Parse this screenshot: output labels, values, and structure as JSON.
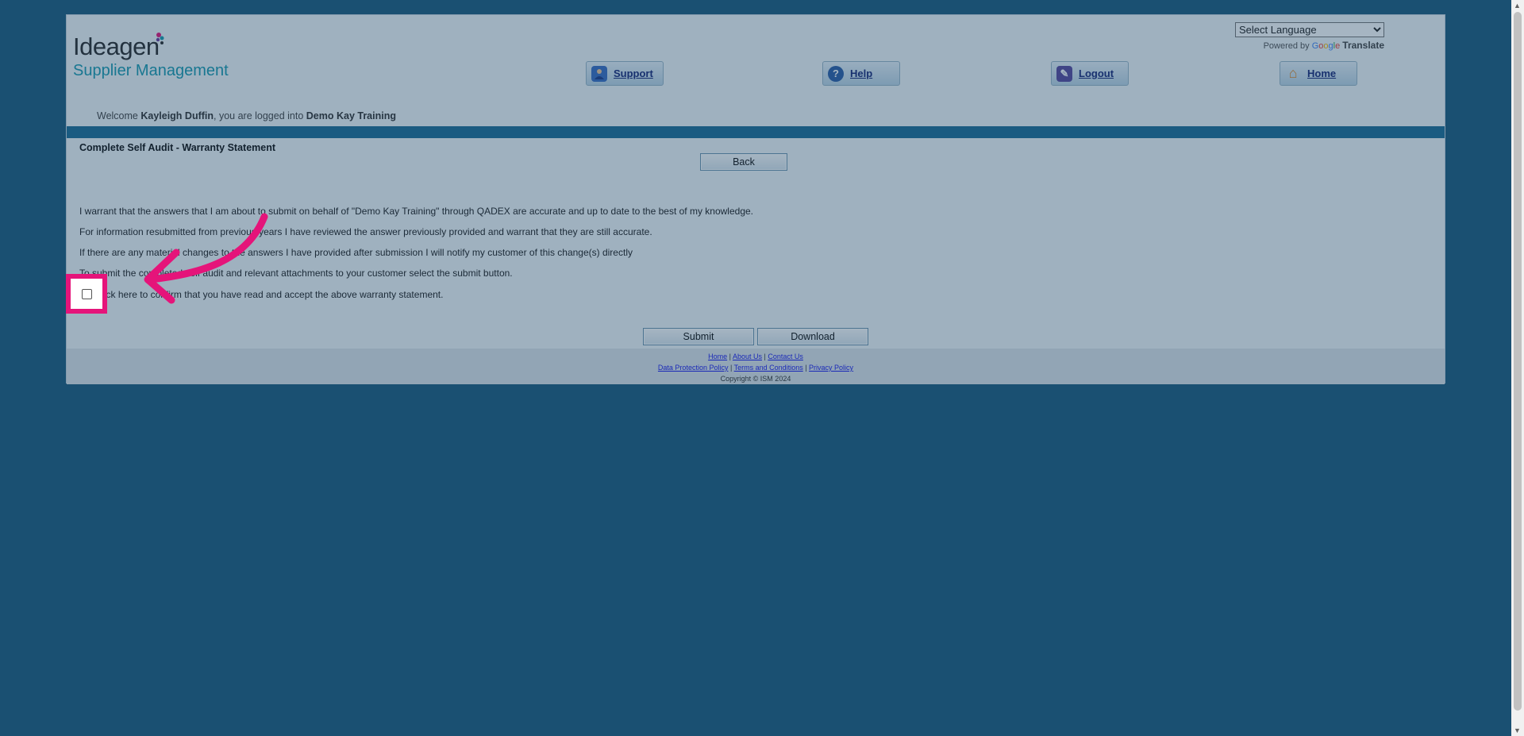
{
  "header": {
    "logo_word": "Ideagen",
    "logo_sub": "Supplier Management",
    "language_select": "Select Language",
    "powered_by": "Powered by",
    "google": [
      "G",
      "o",
      "o",
      "g",
      "l",
      "e"
    ],
    "translate": "Translate"
  },
  "nav": [
    {
      "label": "Support",
      "icon": "support-person-icon",
      "color": "#3a6fc4"
    },
    {
      "label": "Help",
      "icon": "help-question-icon",
      "color": "#2e5fa8"
    },
    {
      "label": "Logout",
      "icon": "logout-pen-icon",
      "color": "#5a4a9e"
    },
    {
      "label": "Home",
      "icon": "home-house-icon",
      "color": "#e08a2b"
    }
  ],
  "welcome": {
    "prefix": "Welcome ",
    "user": "Kayleigh Duffin",
    "middle": ", you are logged into ",
    "org": "Demo Kay Training"
  },
  "main": {
    "heading": "Complete Self Audit  - Warranty Statement",
    "back_label": "Back",
    "paragraphs": [
      "I warrant that the answers that I am about to submit on behalf of \"Demo Kay Training\" through QADEX are accurate and up to date to the best of my knowledge.",
      "For information resubmitted from previous years I have reviewed the answer previously provided and warrant that they are still accurate.",
      "If there are any material changes to the answers I have provided after submission I will notify my customer of this change(s) directly",
      "To submit the completed self audit and relevant attachments to your customer select the submit button."
    ],
    "checkbox_label": "Tick here to confirm that you have read and accept the above warranty statement.",
    "submit_label": "Submit",
    "download_label": "Download"
  },
  "footer": {
    "row1": [
      "Home",
      "About Us",
      "Contact Us"
    ],
    "row2": [
      "Data Protection Policy",
      "Terms and Conditions",
      "Privacy Policy"
    ],
    "copyright": "Copyright © ISM 2024",
    "separator": " | "
  },
  "colors": {
    "background": "#1d5c7e",
    "highlight": "#e5147a",
    "bar": "#1e6f96"
  }
}
